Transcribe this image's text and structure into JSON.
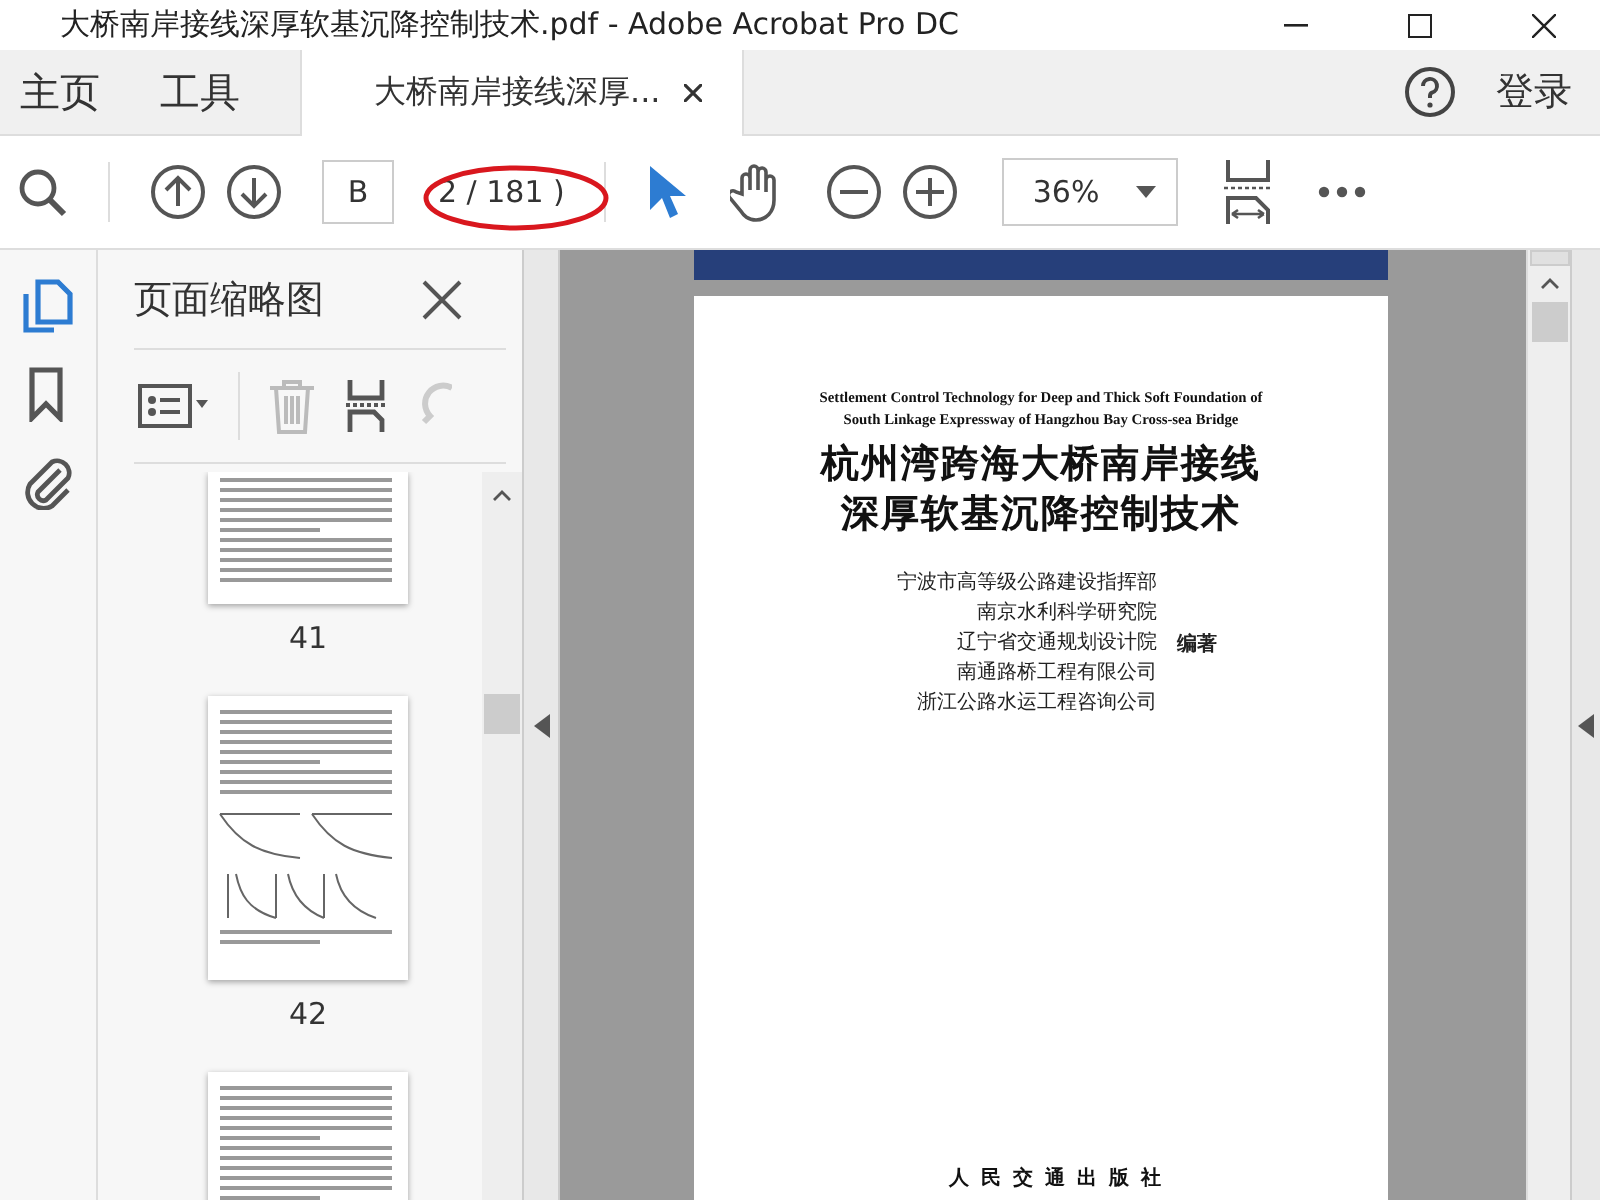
{
  "window": {
    "title": "大桥南岸接线深厚软基沉降控制技术.pdf - Adobe Acrobat Pro DC"
  },
  "tabs": [
    {
      "label": "主页",
      "kind": "nav",
      "selected": false
    },
    {
      "label": "工具",
      "kind": "nav",
      "selected": false
    },
    {
      "label": "大桥南岸接线深厚...",
      "kind": "document",
      "selected": true
    }
  ],
  "sign_in": "登录",
  "toolbar": {
    "page_field": "B",
    "page_count": "2 / 181 )",
    "zoom": "36%"
  },
  "rail": [
    {
      "kind": "pages",
      "selected": true
    },
    {
      "kind": "bookmark",
      "selected": false
    },
    {
      "kind": "attachment",
      "selected": false
    }
  ],
  "sidebar": {
    "title": "页面缩略图",
    "thumbnails": [
      {
        "kind": "text",
        "label": "41"
      },
      {
        "kind": "figure",
        "label": "42"
      },
      {
        "kind": "text"
      }
    ]
  },
  "page": {
    "english_title": [
      "Settlement Control Technology for Deep and Thick Soft Foundation of",
      "South Linkage Expressway of Hangzhou Bay Cross-sea Bridge"
    ],
    "chinese_title": [
      "杭州湾跨海大桥南岸接线",
      "深厚软基沉降控制技术"
    ],
    "authors": [
      "宁波市高等级公路建设指挥部",
      "南京水利科学研究院",
      "辽宁省交通规划设计院",
      "南通路桥工程有限公司",
      "浙江公路水运工程咨询公司"
    ],
    "role": "编著",
    "publisher": "人民交通出版社"
  }
}
